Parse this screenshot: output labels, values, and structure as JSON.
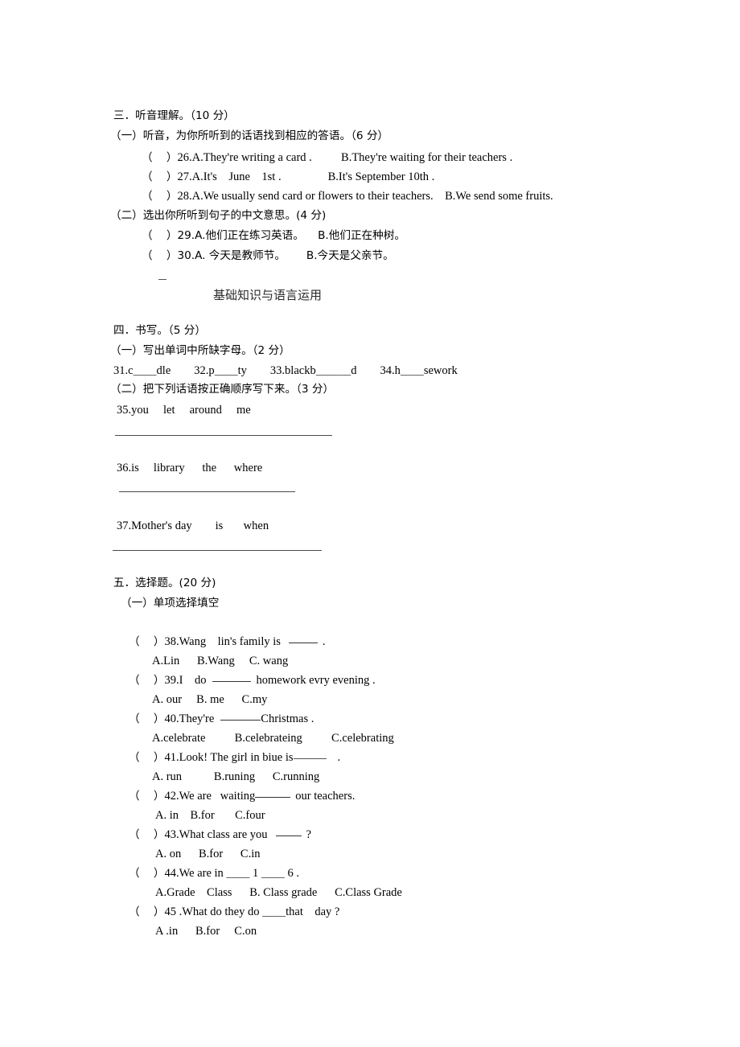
{
  "document": {
    "type": "exam-paper",
    "language": "zh-CN",
    "sections": [
      {
        "id": "section-3",
        "heading": "三．听音理解。（10 分）",
        "subsections": [
          {
            "id": "section-3-part-1",
            "heading": "（一）听音，为你所听到的话语找到相应的答语。（6 分）",
            "items": [
              {
                "bracket": "（    ）",
                "text": "26.A.They're writing a card .          B.They're waiting for their teachers ."
              },
              {
                "bracket": "（    ）",
                "text": "27.A.It's    June    1st .                B.It's September 10th ."
              },
              {
                "bracket": "（    ）",
                "text": "28.A.We usually send card or flowers to their teachers.    B.We send some fruits."
              }
            ]
          },
          {
            "id": "section-3-part-2",
            "heading": "（二）选出你所听到句子的中文意思。(4 分)",
            "items": [
              {
                "bracket": "（    ）",
                "text": "29.A.他们正在练习英语。    B.他们正在种树。"
              },
              {
                "bracket": "（    ）",
                "text": "30.A. 今天是教师节。      B.今天是父亲节。"
              }
            ]
          }
        ]
      },
      {
        "id": "banner",
        "title": "基础知识与语言运用"
      },
      {
        "id": "section-4",
        "heading": "四．书写。（5 分）",
        "subsections": [
          {
            "id": "section-4-part-1",
            "heading": "（一）写出单词中所缺字母。（2 分）",
            "words": "31.c＿＿dle        32.p＿＿ty        33.blackb＿＿＿d        34.h＿＿sework"
          },
          {
            "id": "section-4-part-2",
            "heading": "（二）把下列话语按正确顺序写下来。（3 分）",
            "items": [
              {
                "number": "35.",
                "words": "you     let     around     me"
              },
              {
                "number": "36.",
                "words": "is     library      the      where"
              },
              {
                "number": "37.",
                "words": "Mother's day        is       when"
              }
            ]
          }
        ]
      },
      {
        "id": "section-5",
        "heading": "五．选择题。(20 分)",
        "subsections": [
          {
            "id": "section-5-part-1",
            "heading": "（一）单项选择填空",
            "questions": [
              {
                "bracket": "（    ）",
                "stem": "38.Wang    lin's family is",
                "stem_tail": ".",
                "choices": "A.Lin      B.Wang     C. wang"
              },
              {
                "bracket": "（    ）",
                "stem": "39.I    do",
                "stem_tail": "homework evry evening .",
                "choices": "A. our     B. me      C.my"
              },
              {
                "bracket": "（    ）",
                "stem": "40.They're",
                "stem_tail": "Christmas .",
                "choices": "A.celebrate          B.celebrateing          C.celebrating"
              },
              {
                "bracket": "（    ）",
                "stem": "41.Look! The girl in biue is",
                "stem_tail": ".",
                "choices": "A. run           B.runing      C.running"
              },
              {
                "bracket": "（    ）",
                "stem": "42.We are   waiting",
                "stem_tail": "our teachers.",
                "choices": "A. in    B.for       C.four"
              },
              {
                "bracket": "（    ）",
                "stem": "43.What class are you",
                "stem_tail": "?",
                "choices": "A. on      B.for      C.in"
              },
              {
                "bracket": "（    ）",
                "stem": "44.We are in ＿＿ 1 ＿＿ 6 .",
                "stem_tail": "",
                "choices": "A.Grade    Class      B. Class grade      C.Class Grade"
              },
              {
                "bracket": "（    ）",
                "stem": "45 .What do they do ＿＿that    day ?",
                "stem_tail": "",
                "choices": "A .in      B.for     C.on"
              }
            ]
          }
        ]
      }
    ]
  }
}
